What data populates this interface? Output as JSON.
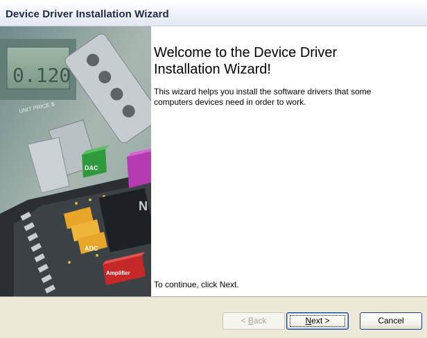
{
  "window": {
    "title": "Device Driver Installation Wizard"
  },
  "art": {
    "meter_reading": "0.120",
    "unit_label": "UNIT PRICE $",
    "chip_labels": {
      "dac": "DAC",
      "adc": "ADC",
      "amplifier": "Amplifier"
    }
  },
  "main": {
    "heading": "Welcome to the Device Driver Installation Wizard!",
    "heading_line1": "Welcome to the Device Driver",
    "heading_line2": "Installation Wizard!",
    "description_line1": "This wizard helps you install the software drivers that some",
    "description_line2": "computers devices need in order to work.",
    "continue_text": "To continue, click Next."
  },
  "buttons": {
    "back_prefix": "< ",
    "back_access": "B",
    "back_rest": "ack",
    "next_access": "N",
    "next_rest": "ext >",
    "cancel": "Cancel",
    "back_enabled": false
  },
  "colors": {
    "title_text": "#1c2b4a",
    "dialog_bg": "#ece9d8",
    "focus_border": "#1e3a8a"
  }
}
